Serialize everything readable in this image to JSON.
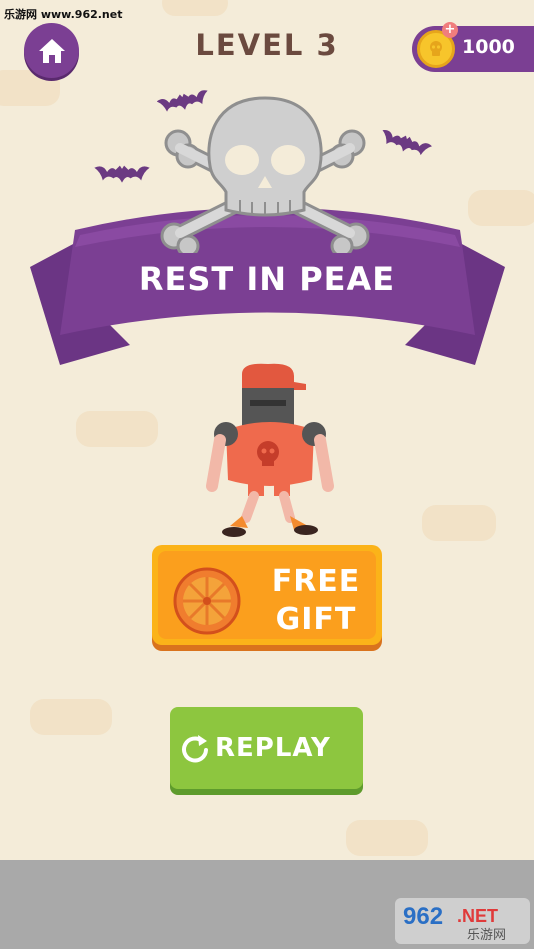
{
  "watermark": "乐游网 www.962.net",
  "header": {
    "level_title": "LEVEL 3",
    "coins": "1000"
  },
  "result": {
    "banner_text": "REST IN PEAE"
  },
  "buttons": {
    "free_gift_line1": "FREE",
    "free_gift_line2": "GIFT",
    "replay": "REPLAY"
  },
  "logo": {
    "brand": "962.NET",
    "subtitle": "乐游网"
  },
  "colors": {
    "background": "#f4ecd9",
    "purple": "#7b3f93",
    "level_text": "#6b4a3f",
    "gift_orange": "#fb9f1d",
    "replay_green": "#8dc63f"
  },
  "icons": [
    "home-icon",
    "coin-icon",
    "plus-icon",
    "skull-crossbones-icon",
    "bat-icon",
    "wheel-icon",
    "replay-icon"
  ]
}
